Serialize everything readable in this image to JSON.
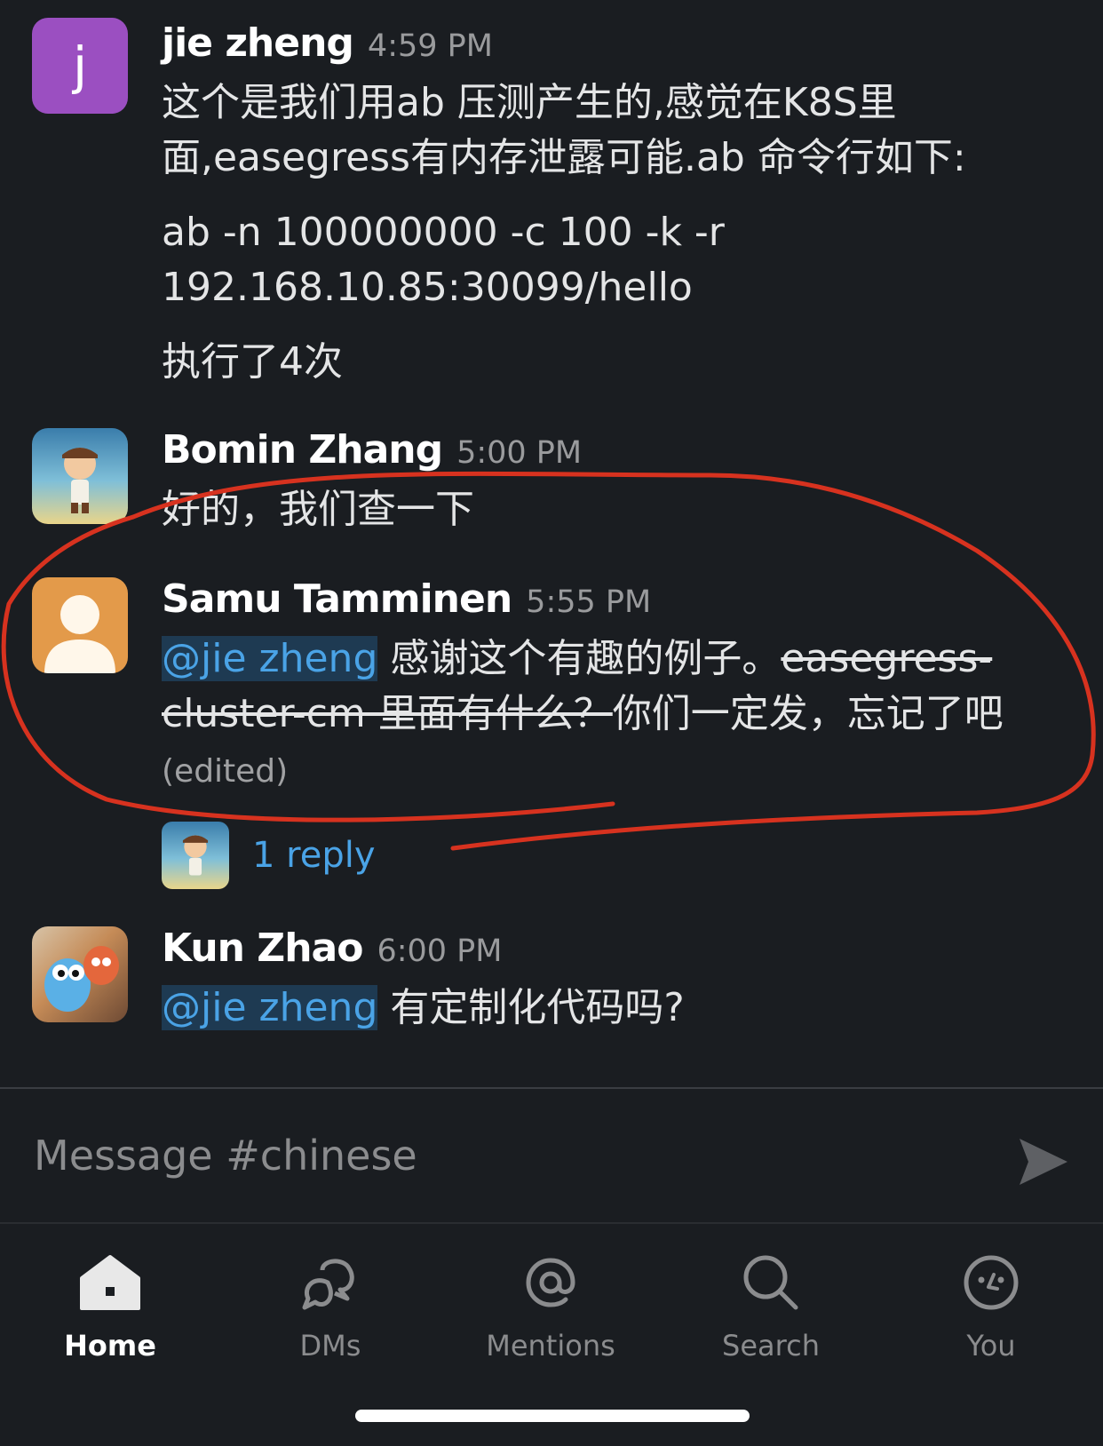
{
  "messages": [
    {
      "avatar_letter": "j",
      "name": "jie zheng",
      "time": "4:59 PM",
      "text1": "这个是我们用ab 压测产生的,感觉在K8S里面,easegress有内存泄露可能.ab 命令行如下:",
      "text2": "ab -n 100000000 -c 100 -k -r 192.168.10.85:30099/hello",
      "text3": "执行了4次"
    },
    {
      "name": "Bomin Zhang",
      "time": "5:00 PM",
      "text": "好的，我们查一下"
    },
    {
      "name": "Samu Tamminen",
      "time": "5:55 PM",
      "mention": "@jie zheng",
      "text_a": " 感谢这个有趣的例子。",
      "text_strike": "easegress-cluster-cm 里面有什么？",
      "text_b": "你们一定发，忘记了吧",
      "edited": "(edited)",
      "reply_count": "1 reply"
    },
    {
      "name": "Kun Zhao",
      "time": "6:00 PM",
      "mention": "@jie zheng",
      "text": " 有定制化代码吗?"
    }
  ],
  "composer": {
    "placeholder": "Message #chinese"
  },
  "tabs": [
    {
      "label": "Home",
      "icon": "home-icon"
    },
    {
      "label": "DMs",
      "icon": "dms-icon"
    },
    {
      "label": "Mentions",
      "icon": "mentions-icon"
    },
    {
      "label": "Search",
      "icon": "search-icon"
    },
    {
      "label": "You",
      "icon": "you-icon"
    }
  ],
  "colors": {
    "background": "#1a1d21",
    "mention": "#4aa3e6",
    "annotation": "#d7321f"
  }
}
